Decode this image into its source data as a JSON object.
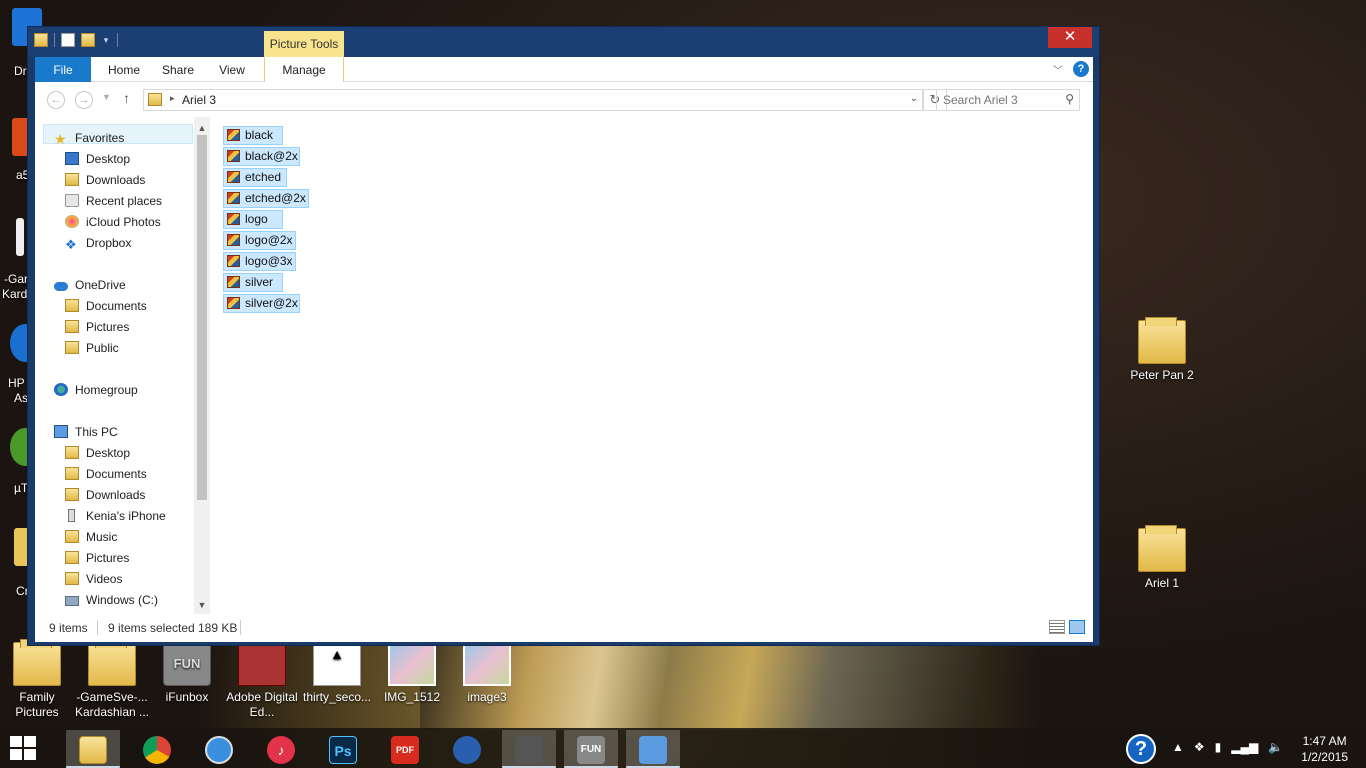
{
  "window": {
    "picture_tools_label": "Picture Tools",
    "close_glyph": "✕",
    "tabs": {
      "file": "File",
      "home": "Home",
      "share": "Share",
      "view": "View",
      "manage": "Manage"
    },
    "address": {
      "path": "Ariel 3",
      "search_placeholder": "Search Ariel 3"
    },
    "nav": {
      "favorites": "Favorites",
      "fav_items": [
        "Desktop",
        "Downloads",
        "Recent places",
        "iCloud Photos",
        "Dropbox"
      ],
      "onedrive": "OneDrive",
      "onedrive_items": [
        "Documents",
        "Pictures",
        "Public"
      ],
      "homegroup": "Homegroup",
      "thispc": "This PC",
      "pc_items": [
        "Desktop",
        "Documents",
        "Downloads",
        "Kenia's iPhone",
        "Music",
        "Pictures",
        "Videos",
        "Windows (C:)"
      ]
    },
    "files": [
      "black",
      "black@2x",
      "etched",
      "etched@2x",
      "logo",
      "logo@2x",
      "logo@3x",
      "silver",
      "silver@2x"
    ],
    "status": {
      "count": "9 items",
      "selected": "9 items selected",
      "size": "189 KB"
    }
  },
  "desktop": {
    "icons": [
      {
        "label": "Peter Pan 2"
      },
      {
        "label": "Ariel 1"
      },
      {
        "label": "Family Pictures"
      },
      {
        "label": "-GameSve-... Kardashian ..."
      },
      {
        "label": "iFunbox"
      },
      {
        "label": "Adobe Digital Ed..."
      },
      {
        "label": "thirty_seco..."
      },
      {
        "label": "IMG_1512"
      },
      {
        "label": "image3"
      }
    ],
    "partial_labels": [
      "Dr",
      "a5",
      "-Gar",
      "Kard",
      "HP",
      "As",
      "µT",
      "Cr"
    ]
  },
  "taskbar": {
    "apps": [
      "File Explorer",
      "Chrome",
      "Safari",
      "iTunes",
      "Ps",
      "PDF",
      "Media",
      "Sync",
      "FUN",
      "Control"
    ],
    "time": "1:47 AM",
    "date": "1/2/2015"
  },
  "colors": {
    "accent": "#1979ca",
    "selection": "#cce8ff",
    "picture_tools": "#f8e48c",
    "close": "#c7302b"
  }
}
